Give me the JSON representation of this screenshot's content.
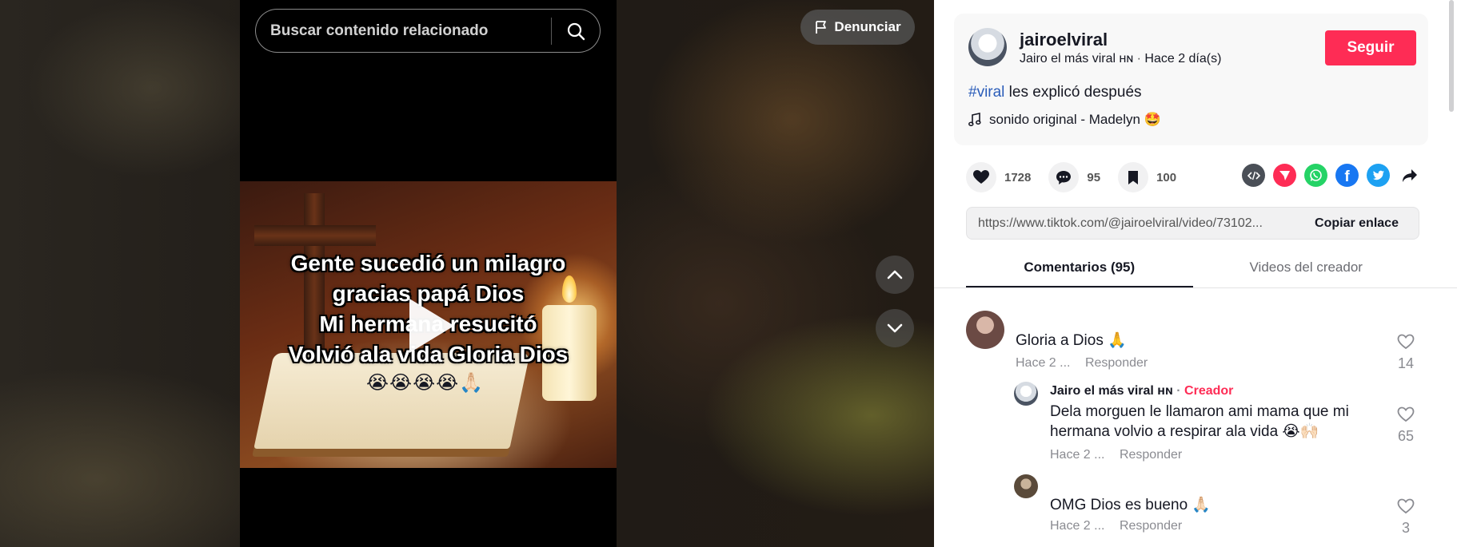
{
  "video": {
    "search_placeholder": "Buscar contenido relacionado",
    "report_label": "Denunciar",
    "caption": "Gente sucedió un milagro\ngracias papá Dios\nMi hermana resucitó\nVolvió ala vida Gloria Dios",
    "caption_emojis": "😭😭😭😭🙏🏻"
  },
  "author": {
    "username": "jairoelviral",
    "display_name": "Jairo el más viral ʜɴ",
    "time_ago": "Hace 2 día(s)",
    "follow_label": "Seguir",
    "hashtag": "#viral",
    "description": " les explicó después",
    "music": "sonido original - Madelyn 🤩"
  },
  "actions": {
    "likes": "1728",
    "comments": "95",
    "saves": "100"
  },
  "share": {
    "link": "https://www.tiktok.com/@jairoelviral/video/73102...",
    "copy_label": "Copiar enlace"
  },
  "tabs": {
    "comments": "Comentarios (95)",
    "creator_videos": "Videos del creador"
  },
  "comments": [
    {
      "text": "Gloria a Dios 🙏",
      "time": "Hace 2 ...",
      "reply": "Responder",
      "likes": "14"
    },
    {
      "name": "Jairo el más viral ʜɴ",
      "creator": "Creador",
      "text": "Dela morguen le llamaron ami mama que mi hermana volvio a respirar ala vida 😭🙌🏻",
      "time": "Hace 2 ...",
      "reply": "Responder",
      "likes": "65"
    },
    {
      "text": "OMG Dios es bueno 🙏🏻",
      "time": "Hace 2 ...",
      "reply": "Responder",
      "likes": "3"
    }
  ],
  "colors": {
    "accent": "#fe2c55",
    "hashtag": "#2b5db9",
    "whatsapp": "#25d366",
    "facebook": "#1877f2",
    "twitter": "#1da1f2",
    "embed": "#4a4f57",
    "send": "#fe2c55"
  }
}
